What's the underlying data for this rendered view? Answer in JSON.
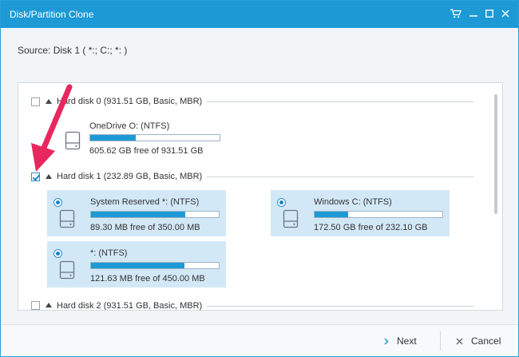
{
  "window": {
    "title": "Disk/Partition Clone",
    "controls": [
      "cart-icon",
      "minimize-icon",
      "maximize-icon",
      "close-icon"
    ],
    "accent_color": "#1d9ad6"
  },
  "source": {
    "label": "Source:  Disk 1 ( *:; C:; *: )"
  },
  "disks": [
    {
      "label": "Hard disk 0 (931.51 GB, Basic, MBR)",
      "checked": false,
      "partitions": [
        {
          "name": "OneDrive O: (NTFS)",
          "free": "605.62 GB free of 931.51 GB",
          "used_fraction": 0.35,
          "selected": false
        }
      ]
    },
    {
      "label": "Hard disk 1 (232.89 GB, Basic, MBR)",
      "checked": true,
      "partitions": [
        {
          "name": "System Reserved *: (NTFS)",
          "free": "89.30 MB free of 350.00 MB",
          "used_fraction": 0.74,
          "selected": true
        },
        {
          "name": "Windows C: (NTFS)",
          "free": "172.50 GB free of 232.10 GB",
          "used_fraction": 0.26,
          "selected": true
        },
        {
          "name": "*: (NTFS)",
          "free": "121.63 MB free of 450.00 MB",
          "used_fraction": 0.73,
          "selected": true
        }
      ]
    },
    {
      "label": "Hard disk 2 (931.51 GB, Basic, MBR)",
      "checked": false,
      "partitions": []
    }
  ],
  "footer": {
    "next_label": "Next",
    "cancel_label": "Cancel"
  },
  "annotation": {
    "arrow_color": "#e8275e"
  }
}
